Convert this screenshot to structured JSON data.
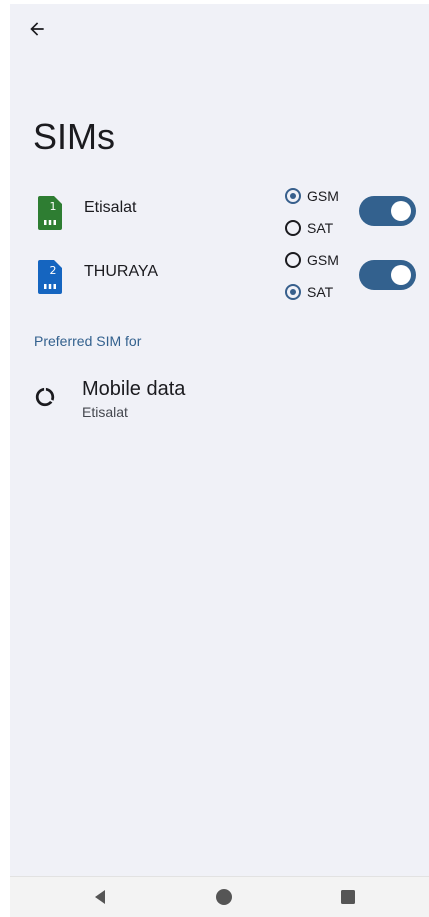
{
  "page": {
    "title": "SIMs"
  },
  "sims": [
    {
      "name": "Etisalat",
      "slot": "1",
      "color": "#2e7d32",
      "options": [
        {
          "label": "GSM",
          "checked": true
        },
        {
          "label": "SAT",
          "checked": false
        }
      ],
      "enabled": true
    },
    {
      "name": "THURAYA",
      "slot": "2",
      "color": "#1565c0",
      "options": [
        {
          "label": "GSM",
          "checked": false
        },
        {
          "label": "SAT",
          "checked": true
        }
      ],
      "enabled": true
    }
  ],
  "preferred": {
    "header": "Preferred SIM for",
    "items": [
      {
        "title": "Mobile data",
        "subtitle": "Etisalat",
        "icon": "data-usage-icon"
      }
    ]
  },
  "colors": {
    "accent": "#33618e",
    "background": "#f0f1f7"
  },
  "nav": {
    "back": "back-triangle-icon",
    "home": "home-circle-icon",
    "recents": "recents-square-icon"
  }
}
